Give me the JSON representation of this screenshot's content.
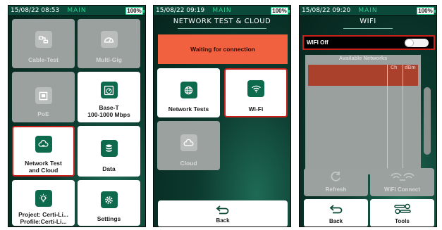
{
  "screens": [
    {
      "status": {
        "time": "15/08/22 08:53",
        "mode": "MAIN",
        "battery": "100%"
      },
      "tiles": [
        {
          "label": "Cable-Test",
          "icon": "cable-icon"
        },
        {
          "label": "Multi-Gig",
          "icon": "gauge-icon"
        },
        {
          "label": "PoE",
          "icon": "poe-port-icon"
        },
        {
          "label_line1": "Base-T",
          "label_line2": "100-1000 Mbps",
          "icon": "speedometer-icon"
        },
        {
          "label_line1": "Network Test",
          "label_line2": "and Cloud",
          "icon": "cloud-network-icon"
        },
        {
          "label": "Data",
          "icon": "database-icon"
        },
        {
          "label_line1": "Project: Certi-Li...",
          "label_line2": "Profile:Certi-Li...",
          "icon": "lightbulb-icon"
        },
        {
          "label": "Settings",
          "icon": "gear-icon"
        }
      ]
    },
    {
      "status": {
        "time": "15/08/22 09:19",
        "mode": "MAIN",
        "battery": "100%"
      },
      "title": "NETWORK TEST & CLOUD",
      "banner": "Waiting for connection",
      "tiles": [
        {
          "label": "Network Tests",
          "icon": "globe-icon"
        },
        {
          "label": "Wi-Fi",
          "icon": "wifi-icon"
        },
        {
          "label": "Cloud",
          "icon": "cloud-icon"
        }
      ],
      "back_label": "Back"
    },
    {
      "status": {
        "time": "15/08/22 09:20",
        "mode": "MAIN",
        "battery": "100%"
      },
      "title": "WIFI",
      "wifi_toggle_label": "WIFI Off",
      "wifi_enabled": false,
      "networks_header": "Available Networks",
      "columns": [
        "Ch",
        "dBm"
      ],
      "buttons": {
        "refresh": "Refresh",
        "wifi_connect": "WiFi Connect",
        "back": "Back",
        "tools": "Tools"
      }
    }
  ]
}
